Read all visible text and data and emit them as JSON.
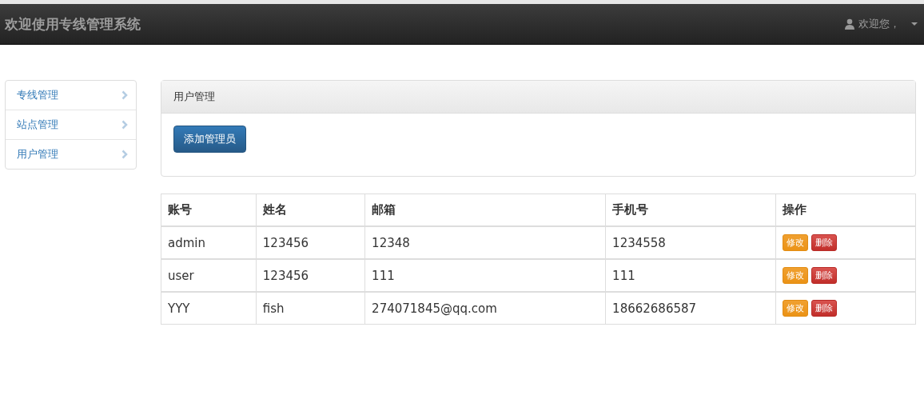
{
  "navbar": {
    "brand": "欢迎使用专线管理系统",
    "user": "欢迎您，"
  },
  "sidebar": {
    "items": [
      {
        "label": "专线管理"
      },
      {
        "label": "站点管理"
      },
      {
        "label": "用户管理"
      }
    ]
  },
  "panel": {
    "title": "用户管理",
    "button": "添加管理员"
  },
  "table": {
    "columns": [
      "账号",
      "姓名",
      "邮箱",
      "手机号",
      "操作"
    ],
    "rows": [
      {
        "cells": [
          "admin",
          "123456",
          "12348",
          "1234558"
        ],
        "actions": [
          {
            "label": "修改",
            "kind": "edit"
          },
          {
            "label": "删除",
            "kind": "delete"
          }
        ]
      },
      {
        "cells": [
          "user",
          "123456",
          "111",
          "111"
        ],
        "actions": [
          {
            "label": "修改",
            "kind": "edit"
          },
          {
            "label": "删除",
            "kind": "delete"
          }
        ]
      },
      {
        "cells": [
          "YYY",
          "fish",
          "274071845@qq.com",
          "18662686587"
        ],
        "actions": [
          {
            "label": "修改",
            "kind": "edit"
          },
          {
            "label": "删除",
            "kind": "delete"
          }
        ]
      }
    ]
  }
}
